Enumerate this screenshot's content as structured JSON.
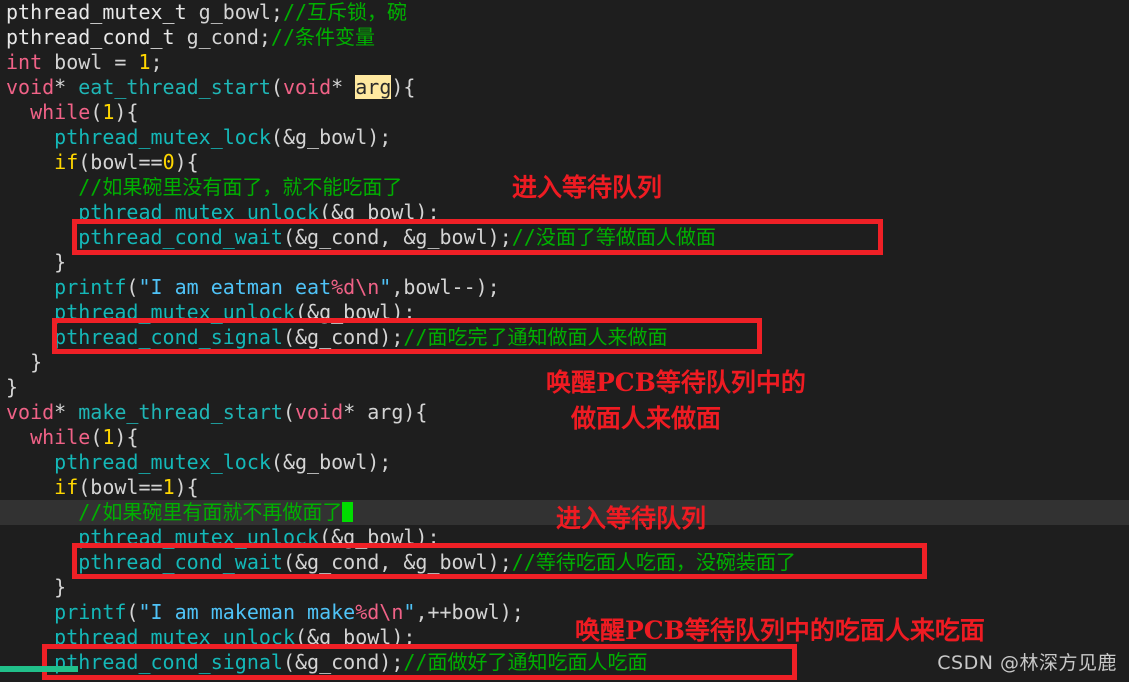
{
  "editor": {
    "background": "#1e1e1e",
    "current_line_background": "#323232",
    "cursor_color": "#00dd00",
    "selection_background": "#ffe9a0",
    "scrollbar_color": "#21c08a",
    "annotation_color": "#ee1b22",
    "box_color": "#ef2026",
    "lines": [
      {
        "n": 1,
        "text": "pthread_mutex_t g_bowl;//互斥锁，碗"
      },
      {
        "n": 2,
        "text": "pthread_cond_t g_cond;//条件变量"
      },
      {
        "n": 3,
        "text": "int bowl = 1;"
      },
      {
        "n": 4,
        "text": "void* eat_thread_start(void* arg){"
      },
      {
        "n": 5,
        "text": "  while(1){"
      },
      {
        "n": 6,
        "text": "    pthread_mutex_lock(&g_bowl);"
      },
      {
        "n": 7,
        "text": "    if(bowl==0){"
      },
      {
        "n": 8,
        "text": "      //如果碗里没有面了，就不能吃面了"
      },
      {
        "n": 9,
        "text": "      pthread_mutex_unlock(&g_bowl);"
      },
      {
        "n": 10,
        "text": "      pthread_cond_wait(&g_cond, &g_bowl);//没面了等做面人做面"
      },
      {
        "n": 11,
        "text": "    }"
      },
      {
        "n": 12,
        "text": "    printf(\"I am eatman eat%d\\n\",bowl--);"
      },
      {
        "n": 13,
        "text": "    pthread_mutex_unlock(&g_bowl);"
      },
      {
        "n": 14,
        "text": "    pthread_cond_signal(&g_cond);//面吃完了通知做面人来做面"
      },
      {
        "n": 15,
        "text": "  }"
      },
      {
        "n": 16,
        "text": "}"
      },
      {
        "n": 17,
        "text": "void* make_thread_start(void* arg){"
      },
      {
        "n": 18,
        "text": "  while(1){"
      },
      {
        "n": 19,
        "text": "    pthread_mutex_lock(&g_bowl);"
      },
      {
        "n": 20,
        "text": "    if(bowl==1){"
      },
      {
        "n": 21,
        "text": "      //如果碗里有面就不再做面了"
      },
      {
        "n": 22,
        "text": "      pthread_mutex_unlock(&g_bowl);"
      },
      {
        "n": 23,
        "text": "      pthread_cond_wait(&g_cond, &g_bowl);//等待吃面人吃面，没碗装面了"
      },
      {
        "n": 24,
        "text": "    }"
      },
      {
        "n": 25,
        "text": "    printf(\"I am makeman make%d\\n\",++bowl);"
      },
      {
        "n": 26,
        "text": "    pthread_mutex_unlock(&g_bowl);"
      },
      {
        "n": 27,
        "text": "    pthread_cond_signal(&g_cond);//面做好了通知吃面人吃面"
      }
    ],
    "selected_token": "arg",
    "current_line_number": 21
  },
  "annotations": [
    {
      "id": "enter-wait-queue-1",
      "text": "进入等待队列"
    },
    {
      "id": "wake-pcb-1-line1",
      "text": "唤醒PCB等待队列中的"
    },
    {
      "id": "wake-pcb-1-line2",
      "text": "做面人来做面"
    },
    {
      "id": "enter-wait-queue-2",
      "text": "进入等待队列"
    },
    {
      "id": "wake-pcb-2",
      "text": "唤醒PCB等待队列中的吃面人来吃面"
    }
  ],
  "highlight_boxes": [
    {
      "id": "box-cond-wait-eat",
      "target_line": 10
    },
    {
      "id": "box-cond-signal-eat",
      "target_line": 14
    },
    {
      "id": "box-cond-wait-make",
      "target_line": 23
    },
    {
      "id": "box-cond-signal-make",
      "target_line": 27
    }
  ],
  "watermark": {
    "text": "CSDN @林深方见鹿"
  }
}
